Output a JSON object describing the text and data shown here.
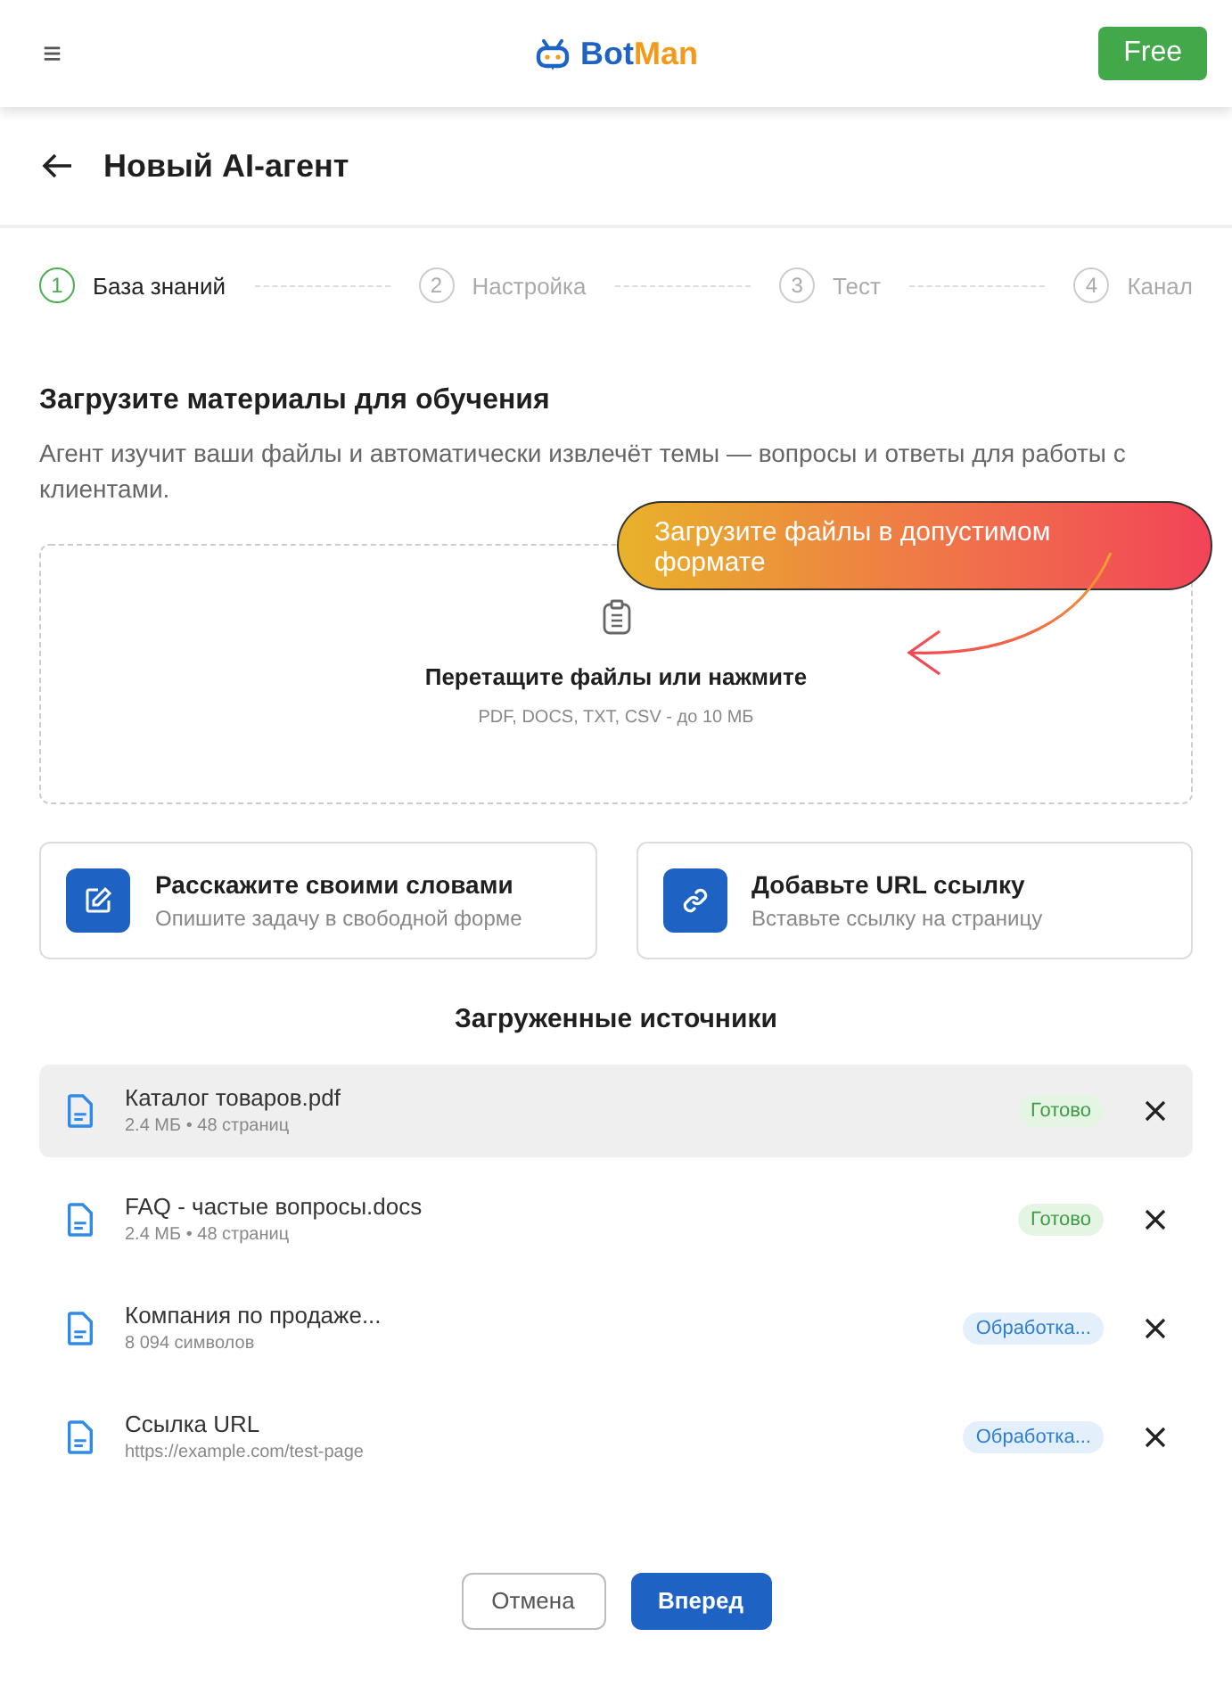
{
  "header": {
    "menu_icon": "≡",
    "logo_parts": [
      "Bot",
      "Man"
    ],
    "plan_button": "Free"
  },
  "page": {
    "title": "Новый AI-агент"
  },
  "steps": [
    {
      "number": "1",
      "label": "База знаний",
      "selected": true
    },
    {
      "number": "2",
      "label": "Настройка",
      "selected": false
    },
    {
      "number": "3",
      "label": "Тест",
      "selected": false
    },
    {
      "number": "4",
      "label": "Канал",
      "selected": false
    }
  ],
  "section": {
    "title": "Загрузите материалы для обучения",
    "description": "Агент изучит ваши файлы и автоматически извлечёт темы — вопросы и ответы для работы с клиентами."
  },
  "dropzone": {
    "title": "Перетащите файлы или нажмите",
    "hint": "PDF, DOCS, TXT, CSV - до 10 МБ"
  },
  "callout": {
    "text": "Загрузите файлы в допустимом формате"
  },
  "options": [
    {
      "kind": "text",
      "title": "Расскажите своими словами",
      "subtitle": "Опишите задачу в свободной форме"
    },
    {
      "kind": "link",
      "title": "Добавьте URL ссылку",
      "subtitle": "Вставьте ссылку на страницу"
    }
  ],
  "sources": {
    "title": "Загруженные источники",
    "items": [
      {
        "name": "Каталог товаров.pdf",
        "meta": "2.4 МБ • 48 страниц",
        "status": "Готово",
        "kind": "done",
        "selected": true
      },
      {
        "name": "FAQ - частые вопросы.docs",
        "meta": "2.4 МБ • 48 страниц",
        "status": "Готово",
        "kind": "done",
        "selected": false
      },
      {
        "name": "Компания по продаже...",
        "meta": "8 094 символов",
        "status": "Обработка...",
        "kind": "processing",
        "selected": false
      },
      {
        "name": "Ссылка URL",
        "meta": "https://example.com/test-page",
        "status": "Обработка...",
        "kind": "processing",
        "selected": false
      }
    ]
  },
  "buttons": {
    "cancel": "Отмена",
    "next": "Вперед"
  }
}
